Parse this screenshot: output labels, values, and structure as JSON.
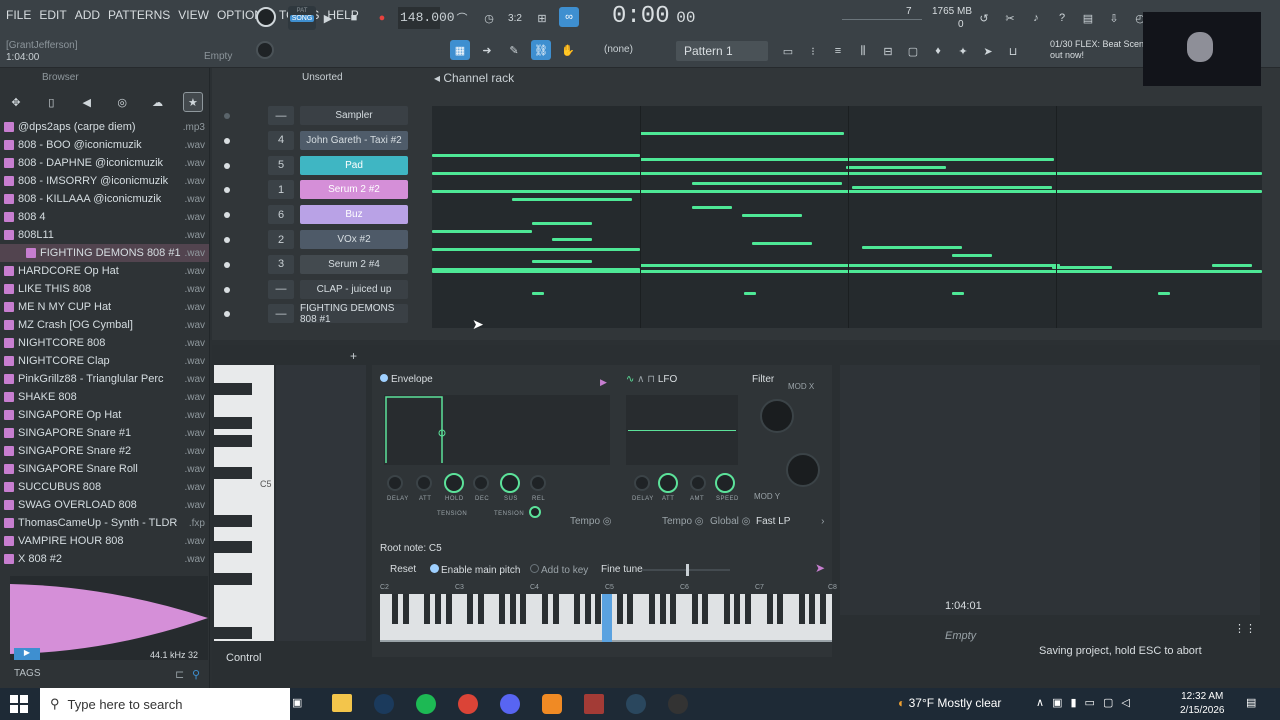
{
  "menu": [
    "FILE",
    "EDIT",
    "ADD",
    "PATTERNS",
    "VIEW",
    "OPTIONS",
    "TOOLS",
    "HELP"
  ],
  "transport": {
    "pat_song": "SONG",
    "tempo": "148.000",
    "time": "0:00",
    "time_small": "00",
    "pattern": "Pattern 1",
    "none": "(none)"
  },
  "hint": {
    "user": "[GrantJefferson]",
    "time": "1:04:00",
    "empty": "Empty"
  },
  "meter": {
    "mem": "1765 MB",
    "cpu": "7",
    "poly": "0"
  },
  "news": {
    "line1": "01/30 FLEX: Beat Scene",
    "line2": "out now!"
  },
  "browser": {
    "title": "Browser",
    "items": [
      {
        "name": "@dps2aps (carpe diem)",
        "ext": ".mp3"
      },
      {
        "name": "808 - BOO @iconicmuzik",
        "ext": ".wav"
      },
      {
        "name": "808 - DAPHNE @iconicmuzik",
        "ext": ".wav"
      },
      {
        "name": "808 - IMSORRY @iconicmuzik",
        "ext": ".wav"
      },
      {
        "name": "808 - KILLAAA @iconicmuzik",
        "ext": ".wav"
      },
      {
        "name": "808 4",
        "ext": ".wav"
      },
      {
        "name": "808L11",
        "ext": ".wav"
      },
      {
        "name": "FIGHTING DEMONS 808 #1",
        "ext": ".wav"
      },
      {
        "name": "HARDCORE Op Hat",
        "ext": ".wav"
      },
      {
        "name": "LIKE THIS 808",
        "ext": ".wav"
      },
      {
        "name": "ME N MY CUP Hat",
        "ext": ".wav"
      },
      {
        "name": "MZ Crash [OG Cymbal]",
        "ext": ".wav"
      },
      {
        "name": "NIGHTCORE 808",
        "ext": ".wav"
      },
      {
        "name": "NIGHTCORE Clap",
        "ext": ".wav"
      },
      {
        "name": "PinkGrillz88 - Trianglular Perc",
        "ext": ".wav"
      },
      {
        "name": "SHAKE 808",
        "ext": ".wav"
      },
      {
        "name": "SINGAPORE Op Hat",
        "ext": ".wav"
      },
      {
        "name": "SINGAPORE Snare #1",
        "ext": ".wav"
      },
      {
        "name": "SINGAPORE Snare #2",
        "ext": ".wav"
      },
      {
        "name": "SINGAPORE Snare Roll",
        "ext": ".wav"
      },
      {
        "name": "SUCCUBUS 808",
        "ext": ".wav"
      },
      {
        "name": "SWAG OVERLOAD 808",
        "ext": ".wav"
      },
      {
        "name": "ThomasCameUp - Synth - TLDR",
        "ext": ".fxp"
      },
      {
        "name": "VAMPIRE HOUR 808",
        "ext": ".wav"
      },
      {
        "name": "X 808 #2",
        "ext": ".wav"
      }
    ],
    "sample_info": "44.1 kHz 32",
    "tags": "TAGS"
  },
  "rack": {
    "filter": "Unsorted",
    "title": "Channel rack",
    "channels": [
      {
        "num": "—",
        "name": "Sampler",
        "color": "#3a4045"
      },
      {
        "num": "4",
        "name": "John Gareth - Taxi #2",
        "color": "#4f5c6a"
      },
      {
        "num": "5",
        "name": "Pad",
        "color": "#3fb6c3"
      },
      {
        "num": "1",
        "name": "Serum 2 #2",
        "color": "#d58fd8"
      },
      {
        "num": "6",
        "name": "Buz",
        "color": "#b9a2e6"
      },
      {
        "num": "2",
        "name": "VOx #2",
        "color": "#4e5a68"
      },
      {
        "num": "3",
        "name": "Serum 2 #4",
        "color": "#434a4f"
      },
      {
        "num": "—",
        "name": "CLAP - juiced up",
        "color": "#3a4045"
      },
      {
        "num": "—",
        "name": "FIGHTING DEMONS 808 #1",
        "color": "#3a4045"
      }
    ]
  },
  "plugin": {
    "envelope": "Envelope",
    "lfo": "LFO",
    "filter": "Filter",
    "modx": "MOD X",
    "mody": "MOD Y",
    "env_knobs": [
      "DELAY",
      "ATT",
      "HOLD",
      "DEC",
      "SUS",
      "REL"
    ],
    "tension": "TENSION",
    "lfo_knobs": [
      "DELAY",
      "ATT",
      "AMT",
      "SPEED"
    ],
    "tempo": "Tempo",
    "global": "Global",
    "filter_type": "Fast LP",
    "root_note": "Root note: C5",
    "reset": "Reset",
    "enable_pitch": "Enable main pitch",
    "add_key": "Add to key",
    "fine_tune": "Fine tune",
    "octaves": [
      "C2",
      "C3",
      "C4",
      "C5",
      "C6",
      "C7",
      "C8"
    ],
    "roll_note": "C5",
    "control": "Control",
    "clock": "1:04:01",
    "empty": "Empty",
    "saving": "Saving project, hold ESC to abort"
  },
  "taskbar": {
    "search": "Type here to search",
    "weather": "37°F  Mostly clear",
    "time": "12:32 AM",
    "date": "2/15/2026"
  }
}
